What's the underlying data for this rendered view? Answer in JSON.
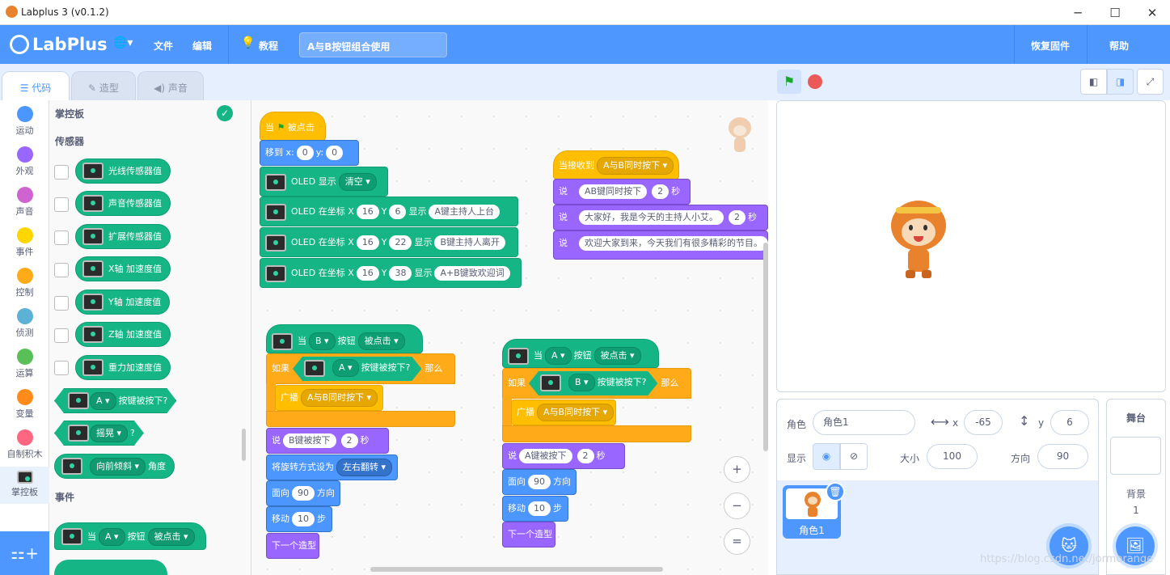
{
  "window": {
    "title": "Labplus 3 (v0.1.2)",
    "minimize": "─",
    "maximize": "☐",
    "close": "✕"
  },
  "menubar": {
    "logo": "LabPlus",
    "globe": "🌐▾",
    "file": "文件",
    "edit": "编辑",
    "tutorial": "教程",
    "project_name": "A与B按钮组合使用",
    "restore_firmware": "恢复固件",
    "help": "帮助"
  },
  "tabs": [
    {
      "label": "代码"
    },
    {
      "label": "造型"
    },
    {
      "label": "声音"
    }
  ],
  "categories": [
    {
      "label": "运动",
      "color": "#4c97ff"
    },
    {
      "label": "外观",
      "color": "#9966ff"
    },
    {
      "label": "声音",
      "color": "#cf63cf"
    },
    {
      "label": "事件",
      "color": "#ffd500"
    },
    {
      "label": "控制",
      "color": "#ffab19"
    },
    {
      "label": "侦测",
      "color": "#5cb1d6"
    },
    {
      "label": "运算",
      "color": "#59c059"
    },
    {
      "label": "变量",
      "color": "#ff8c1a"
    },
    {
      "label": "自制积木",
      "color": "#ff6680"
    },
    {
      "label": "掌控板",
      "color": "#16b586"
    }
  ],
  "palette": {
    "section_title": "掌控板",
    "sensors_heading": "传感器",
    "events_heading": "事件",
    "reporters": [
      "光线传感器值",
      "声音传感器值",
      "扩展传感器值",
      "X轴 加速度值",
      "Y轴 加速度值",
      "Z轴 加速度值",
      "重力加速度值"
    ],
    "button_pressed": {
      "key": "A",
      "label": "按键被按下?"
    },
    "shake": {
      "value": "摇晃",
      "suffix": "?"
    },
    "tilt": {
      "value": "向前倾斜",
      "label": "角度"
    },
    "event_hat": {
      "prefix": "当",
      "key": "A",
      "btn": "按钮",
      "action": "被点击"
    }
  },
  "script1": {
    "hat": {
      "prefix": "当",
      "suffix": "被点击"
    },
    "goto": {
      "label": "移到 x:",
      "x": "0",
      "ylabel": "y:",
      "y": "0"
    },
    "oled_clear": {
      "label": "OLED 显示",
      "value": "清空"
    },
    "oled_lines": [
      {
        "label": "OLED 在坐标 X",
        "x": "16",
        "ylabel": "Y",
        "y": "6",
        "show": "显示",
        "text": "A键主持人上台"
      },
      {
        "label": "OLED 在坐标 X",
        "x": "16",
        "ylabel": "Y",
        "y": "22",
        "show": "显示",
        "text": "B键主持人离开"
      },
      {
        "label": "OLED 在坐标 X",
        "x": "16",
        "ylabel": "Y",
        "y": "38",
        "show": "显示",
        "text": "A+B键致欢迎词"
      }
    ]
  },
  "script2": {
    "hat": {
      "label": "当接收到",
      "msg": "A与B同时按下"
    },
    "says": [
      {
        "label": "说",
        "text": "AB键同时按下",
        "secs": "2",
        "unit": "秒"
      },
      {
        "label": "说",
        "text": "大家好，我是今天的主持人小艾。",
        "secs": "2",
        "unit": "秒"
      },
      {
        "label": "说",
        "text": "欢迎大家到来，今天我们有很多精彩的节目。"
      }
    ]
  },
  "script3": {
    "hat": {
      "prefix": "当",
      "key": "B",
      "btn": "按钮",
      "action": "被点击"
    },
    "if": {
      "label": "如果",
      "key": "A",
      "cond": "按键被按下?",
      "then": "那么"
    },
    "broadcast": {
      "label": "广播",
      "msg": "A与B同时按下"
    },
    "say": {
      "label": "说",
      "text": "B键被按下",
      "secs": "2",
      "unit": "秒"
    },
    "rotation": {
      "label": "将旋转方式设为",
      "value": "左右翻转"
    },
    "face": {
      "label": "面向",
      "value": "90",
      "unit": "方向"
    },
    "move": {
      "label": "移动",
      "value": "10",
      "unit": "步"
    },
    "next": {
      "label": "下一个造型"
    }
  },
  "script4": {
    "hat": {
      "prefix": "当",
      "key": "A",
      "btn": "按钮",
      "action": "被点击"
    },
    "if": {
      "label": "如果",
      "key": "B",
      "cond": "按键被按下?",
      "then": "那么"
    },
    "broadcast": {
      "label": "广播",
      "msg": "A与B同时按下"
    },
    "say": {
      "label": "说",
      "text": "A键被按下",
      "secs": "2",
      "unit": "秒"
    },
    "face": {
      "label": "面向",
      "value": "90",
      "unit": "方向"
    },
    "move": {
      "label": "移动",
      "value": "10",
      "unit": "步"
    },
    "next": {
      "label": "下一个造型"
    }
  },
  "zoom": {
    "in": "+",
    "out": "−",
    "reset": "="
  },
  "sprite": {
    "label": "角色",
    "name": "角色1",
    "x_label": "x",
    "x": "-65",
    "y_label": "y",
    "y": "6",
    "show_label": "显示",
    "size_label": "大小",
    "size": "100",
    "dir_label": "方向",
    "dir": "90",
    "card_name": "角色1"
  },
  "stage_panel": {
    "title": "舞台",
    "backdrop_label": "背景",
    "backdrop_count": "1"
  },
  "watermark": "https://blog.csdn.net/jormorange",
  "colors": {
    "accent": "#4d97ff",
    "board": "#16b586",
    "events": "#ffbf00",
    "looks": "#9966ff",
    "motion": "#4c97ff",
    "control": "#ffab19"
  }
}
